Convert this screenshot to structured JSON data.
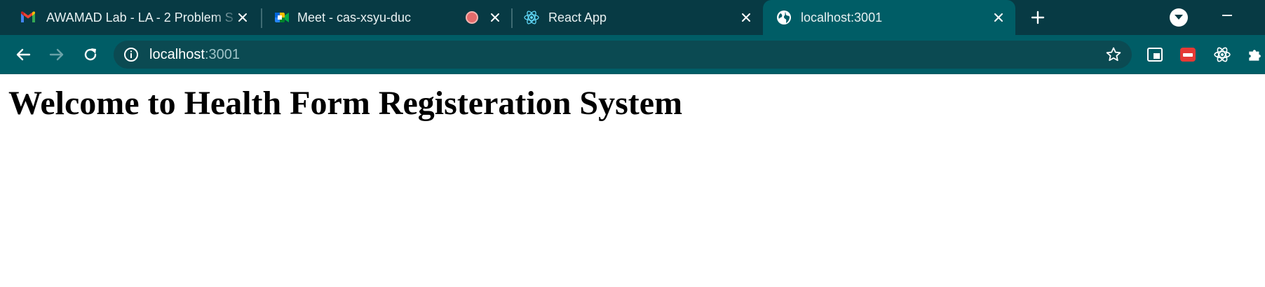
{
  "browser": {
    "tabs": [
      {
        "title": "AWAMAD Lab - LA - 2 Problem S",
        "favicon": "gmail-icon",
        "active": false
      },
      {
        "title": "Meet - cas-xsyu-duc",
        "favicon": "google-meet-icon",
        "recording": true,
        "active": false
      },
      {
        "title": "React App",
        "favicon": "react-icon",
        "active": false
      },
      {
        "title": "localhost:3001",
        "favicon": "globe-icon",
        "active": true
      }
    ],
    "address_bar": {
      "host": "localhost",
      "port": ":3001"
    },
    "extensions": [
      "tab-search-icon",
      "youtube-extension-icon",
      "react-devtools-icon",
      "puzzle-icon"
    ]
  },
  "page": {
    "heading": "Welcome to Health Form Registeration System"
  },
  "colors": {
    "tabstrip_bg": "#073a44",
    "active_tab_bg": "#005d66",
    "omnibox_bg": "#0b4a52",
    "page_bg": "#ffffff"
  }
}
